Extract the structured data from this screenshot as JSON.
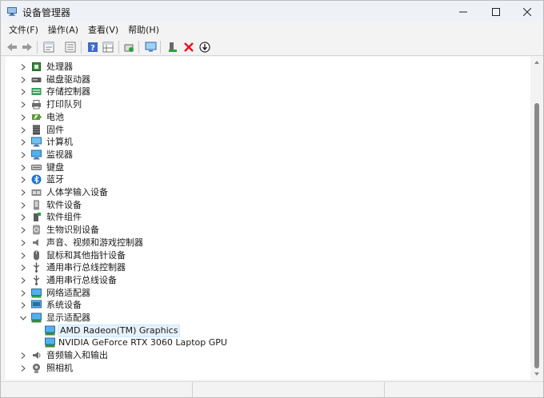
{
  "window": {
    "title": "设备管理器"
  },
  "menu": [
    "文件(F)",
    "操作(A)",
    "查看(V)",
    "帮助(H)"
  ],
  "toolbar": {
    "buttons": [
      "back-arrow",
      "forward-arrow",
      "properties-sheet",
      "update-list",
      "help-question",
      "view-grid",
      "scan-hardware",
      "monitor-display",
      "add-driver",
      "remove-device",
      "download-driver"
    ]
  },
  "tree": {
    "categories": [
      {
        "label": "处理器",
        "icon": "cpu",
        "expanded": false
      },
      {
        "label": "磁盘驱动器",
        "icon": "disk",
        "expanded": false
      },
      {
        "label": "存储控制器",
        "icon": "storage",
        "expanded": false
      },
      {
        "label": "打印队列",
        "icon": "printer",
        "expanded": false
      },
      {
        "label": "电池",
        "icon": "battery",
        "expanded": false
      },
      {
        "label": "固件",
        "icon": "firmware",
        "expanded": false
      },
      {
        "label": "计算机",
        "icon": "computer",
        "expanded": false
      },
      {
        "label": "监视器",
        "icon": "monitor",
        "expanded": false
      },
      {
        "label": "键盘",
        "icon": "keyboard",
        "expanded": false
      },
      {
        "label": "蓝牙",
        "icon": "bluetooth",
        "expanded": false
      },
      {
        "label": "人体学输入设备",
        "icon": "hid",
        "expanded": false
      },
      {
        "label": "软件设备",
        "icon": "software-device",
        "expanded": false
      },
      {
        "label": "软件组件",
        "icon": "software-component",
        "expanded": false
      },
      {
        "label": "生物识别设备",
        "icon": "biometric",
        "expanded": false
      },
      {
        "label": "声音、视频和游戏控制器",
        "icon": "sound",
        "expanded": false
      },
      {
        "label": "鼠标和其他指针设备",
        "icon": "mouse",
        "expanded": false
      },
      {
        "label": "通用串行总线控制器",
        "icon": "usb",
        "expanded": false
      },
      {
        "label": "通用串行总线设备",
        "icon": "usb",
        "expanded": false
      },
      {
        "label": "网络适配器",
        "icon": "network",
        "expanded": false
      },
      {
        "label": "系统设备",
        "icon": "system",
        "expanded": false
      },
      {
        "label": "显示适配器",
        "icon": "display-adapter",
        "expanded": true,
        "children": [
          {
            "label": "AMD Radeon(TM) Graphics",
            "selected": true
          },
          {
            "label": "NVIDIA GeForce RTX 3060 Laptop GPU",
            "selected": false
          }
        ]
      },
      {
        "label": "音频输入和输出",
        "icon": "audio",
        "expanded": false
      },
      {
        "label": "照相机",
        "icon": "camera",
        "expanded": false
      }
    ]
  },
  "colors": {
    "accent": "#0078d4",
    "selection": "#e5f1fb",
    "remove_red": "#e81123",
    "add_green": "#2e9f3e"
  }
}
